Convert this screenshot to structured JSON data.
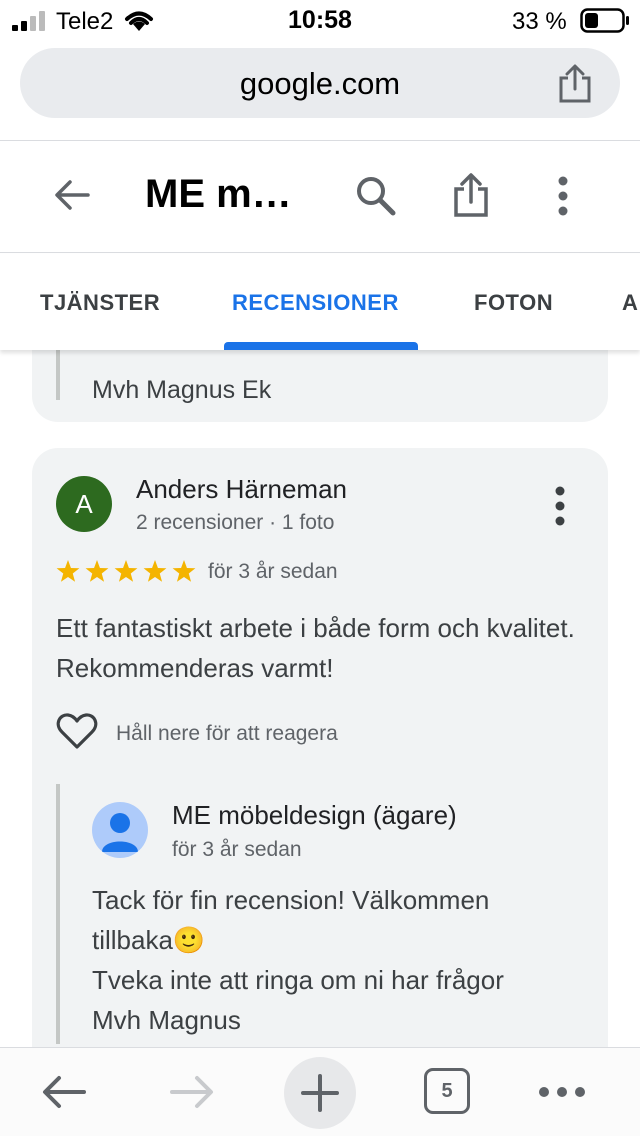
{
  "status_bar": {
    "carrier": "Tele2",
    "time": "10:58",
    "battery": "33 %"
  },
  "browser": {
    "url": "google.com",
    "open_tabs": "5"
  },
  "header": {
    "title": "ME m…"
  },
  "tabs": [
    {
      "label": "TJÄNSTER",
      "active": false
    },
    {
      "label": "RECENSIONER",
      "active": true
    },
    {
      "label": "FOTON",
      "active": false
    },
    {
      "label": "A",
      "active": false
    }
  ],
  "previous_reply_tail": "Mvh Magnus Ek",
  "review": {
    "avatar_letter": "A",
    "author": "Anders Härneman",
    "meta": "2 recensioner · 1 foto",
    "rating": 5,
    "date": "för 3 år sedan",
    "text": "Ett fantastiskt arbete i både form och kvalitet. Rekommenderas varmt!",
    "react_hint": "Håll nere för att reagera",
    "owner_reply": {
      "author": "ME möbeldesign (ägare)",
      "date": "för 3 år sedan",
      "lines": [
        "Tack för fin recension! Välkommen",
        "tillbaka🙂",
        "Tveka inte att ringa om ni har frågor",
        "Mvh Magnus"
      ]
    }
  },
  "colors": {
    "accent": "#1a73e8",
    "star": "#f4b400",
    "avatar": "#2d6a1f"
  }
}
